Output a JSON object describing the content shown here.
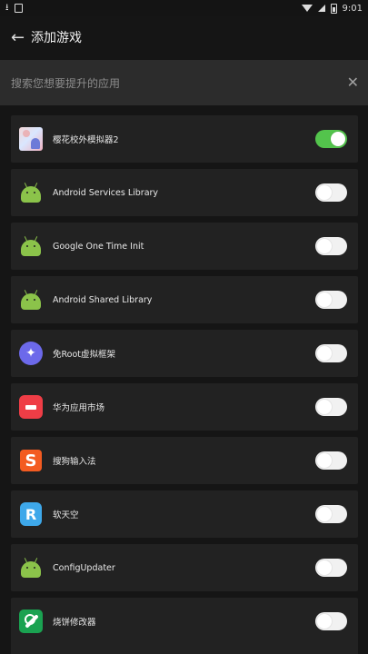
{
  "status_bar": {
    "time": "9:01"
  },
  "header": {
    "back_icon": "arrow-left-icon",
    "title": "添加游戏"
  },
  "search": {
    "placeholder": "搜索您想要提升的应用",
    "close_icon": "close-icon"
  },
  "apps": [
    {
      "name": "樱花校外模拟器2",
      "icon": "anime-game-icon",
      "enabled": true
    },
    {
      "name": "Android Services Library",
      "icon": "android-icon",
      "enabled": false
    },
    {
      "name": "Google One Time Init",
      "icon": "android-icon",
      "enabled": false
    },
    {
      "name": "Android Shared Library",
      "icon": "android-icon",
      "enabled": false
    },
    {
      "name": "免Root虚拟框架",
      "icon": "purple-sparkle-icon",
      "enabled": false
    },
    {
      "name": "华为应用市场",
      "icon": "huawei-appgallery-icon",
      "enabled": false
    },
    {
      "name": "搜狗输入法",
      "icon": "sogou-input-icon",
      "enabled": false
    },
    {
      "name": "软天空",
      "icon": "ruan-tiankong-icon",
      "enabled": false
    },
    {
      "name": "ConfigUpdater",
      "icon": "android-icon",
      "enabled": false
    },
    {
      "name": "烧饼修改器",
      "icon": "wrench-icon",
      "enabled": false
    }
  ],
  "colors": {
    "background": "#151515",
    "card": "#222222",
    "search_bar": "#2c2c2c",
    "toggle_on": "#53c44c",
    "toggle_off": "#f1f1f1"
  }
}
